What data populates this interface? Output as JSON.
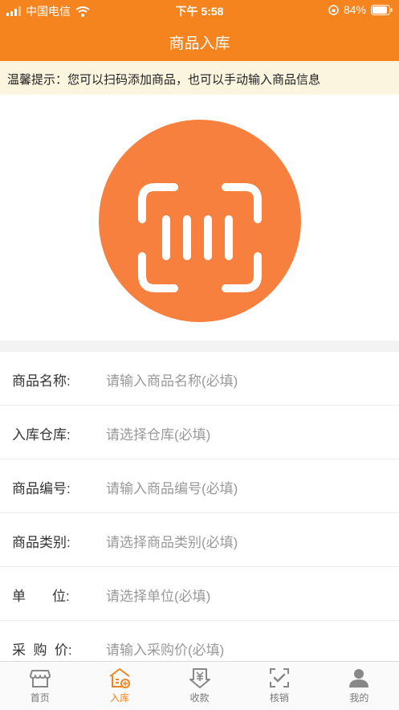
{
  "status_bar": {
    "carrier": "中国电信",
    "time": "下午 5:58",
    "battery": "84%"
  },
  "nav": {
    "title": "商品入库"
  },
  "tip": {
    "text": "温馨提示：您可以扫码添加商品，也可以手动输入商品信息"
  },
  "colors": {
    "primary": "#f5841f",
    "scan_circle": "#f7803e",
    "tip_bg": "#fbf5e0"
  },
  "scan": {
    "icon": "barcode-scan-icon"
  },
  "form": {
    "rows": [
      {
        "label": "商品名称:",
        "placeholder": "请输入商品名称(必填)"
      },
      {
        "label": "入库仓库:",
        "placeholder": "请选择仓库(必填)"
      },
      {
        "label": "商品编号:",
        "placeholder": "请输入商品编号(必填)"
      },
      {
        "label": "商品类别:",
        "placeholder": "请选择商品类别(必填)"
      },
      {
        "label": "单       位:",
        "placeholder": "请选择单位(必填)"
      },
      {
        "label": "采  购  价:",
        "placeholder": "请输入采购价(必填)"
      }
    ]
  },
  "tabs": [
    {
      "label": "首页",
      "icon": "shop-icon",
      "active": false
    },
    {
      "label": "入库",
      "icon": "stock-in-icon",
      "active": true
    },
    {
      "label": "收款",
      "icon": "yuan-receive-icon",
      "active": false
    },
    {
      "label": "核销",
      "icon": "verify-check-icon",
      "active": false
    },
    {
      "label": "我的",
      "icon": "user-icon",
      "active": false
    }
  ]
}
